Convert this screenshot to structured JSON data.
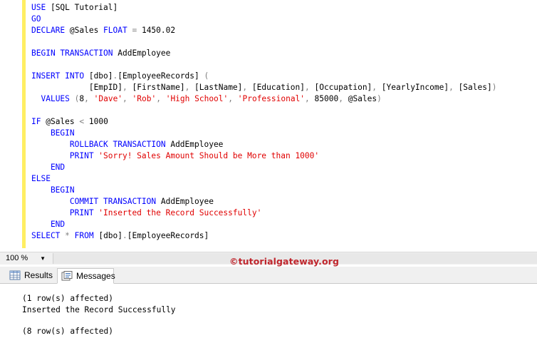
{
  "editor": {
    "lines": [
      [
        {
          "t": "USE ",
          "c": "kw"
        },
        {
          "t": "[SQL Tutorial]",
          "c": "pl"
        }
      ],
      [
        {
          "t": "GO",
          "c": "kw"
        }
      ],
      [
        {
          "t": "DECLARE ",
          "c": "kw"
        },
        {
          "t": "@Sales ",
          "c": "pl"
        },
        {
          "t": "FLOAT ",
          "c": "kw"
        },
        {
          "t": "= ",
          "c": "op"
        },
        {
          "t": "1450.02",
          "c": "pl"
        }
      ],
      [],
      [
        {
          "t": "BEGIN TRANSACTION ",
          "c": "kw"
        },
        {
          "t": "AddEmployee",
          "c": "pl"
        }
      ],
      [],
      [
        {
          "t": "INSERT INTO ",
          "c": "kw"
        },
        {
          "t": "[dbo]",
          "c": "pl"
        },
        {
          "t": ".",
          "c": "op"
        },
        {
          "t": "[EmployeeRecords] ",
          "c": "pl"
        },
        {
          "t": "(",
          "c": "op"
        }
      ],
      [
        {
          "t": "            ",
          "c": "pl"
        },
        {
          "t": "[EmpID]",
          "c": "pl"
        },
        {
          "t": ", ",
          "c": "op"
        },
        {
          "t": "[FirstName]",
          "c": "pl"
        },
        {
          "t": ", ",
          "c": "op"
        },
        {
          "t": "[LastName]",
          "c": "pl"
        },
        {
          "t": ", ",
          "c": "op"
        },
        {
          "t": "[Education]",
          "c": "pl"
        },
        {
          "t": ", ",
          "c": "op"
        },
        {
          "t": "[Occupation]",
          "c": "pl"
        },
        {
          "t": ", ",
          "c": "op"
        },
        {
          "t": "[YearlyIncome]",
          "c": "pl"
        },
        {
          "t": ", ",
          "c": "op"
        },
        {
          "t": "[Sales]",
          "c": "pl"
        },
        {
          "t": ")",
          "c": "op"
        }
      ],
      [
        {
          "t": "  ",
          "c": "pl"
        },
        {
          "t": "VALUES ",
          "c": "kw"
        },
        {
          "t": "(",
          "c": "op"
        },
        {
          "t": "8",
          "c": "pl"
        },
        {
          "t": ", ",
          "c": "op"
        },
        {
          "t": "'Dave'",
          "c": "str"
        },
        {
          "t": ", ",
          "c": "op"
        },
        {
          "t": "'Rob'",
          "c": "str"
        },
        {
          "t": ", ",
          "c": "op"
        },
        {
          "t": "'High School'",
          "c": "str"
        },
        {
          "t": ", ",
          "c": "op"
        },
        {
          "t": "'Professional'",
          "c": "str"
        },
        {
          "t": ", ",
          "c": "op"
        },
        {
          "t": "85000",
          "c": "pl"
        },
        {
          "t": ", ",
          "c": "op"
        },
        {
          "t": "@Sales",
          "c": "pl"
        },
        {
          "t": ")",
          "c": "op"
        }
      ],
      [],
      [
        {
          "t": "IF ",
          "c": "kw"
        },
        {
          "t": "@Sales ",
          "c": "pl"
        },
        {
          "t": "< ",
          "c": "op"
        },
        {
          "t": "1000",
          "c": "pl"
        }
      ],
      [
        {
          "t": "    BEGIN",
          "c": "kw"
        }
      ],
      [
        {
          "t": "        ROLLBACK TRANSACTION ",
          "c": "kw"
        },
        {
          "t": "AddEmployee",
          "c": "pl"
        }
      ],
      [
        {
          "t": "        PRINT ",
          "c": "kw"
        },
        {
          "t": "'Sorry! Sales Amount Should be More than 1000'",
          "c": "str"
        }
      ],
      [
        {
          "t": "    END",
          "c": "kw"
        }
      ],
      [
        {
          "t": "ELSE",
          "c": "kw"
        }
      ],
      [
        {
          "t": "    BEGIN",
          "c": "kw"
        }
      ],
      [
        {
          "t": "        COMMIT TRANSACTION ",
          "c": "kw"
        },
        {
          "t": "AddEmployee",
          "c": "pl"
        }
      ],
      [
        {
          "t": "        PRINT ",
          "c": "kw"
        },
        {
          "t": "'Inserted the Record Successfully'",
          "c": "str"
        }
      ],
      [
        {
          "t": "    END",
          "c": "kw"
        }
      ],
      [
        {
          "t": "SELECT ",
          "c": "kw"
        },
        {
          "t": "* ",
          "c": "op"
        },
        {
          "t": "FROM ",
          "c": "kw"
        },
        {
          "t": "[dbo]",
          "c": "pl"
        },
        {
          "t": ".",
          "c": "op"
        },
        {
          "t": "[EmployeeRecords]",
          "c": "pl"
        }
      ]
    ]
  },
  "zoom": {
    "value": "100 %"
  },
  "watermark": "©tutorialgateway.org",
  "tabs": {
    "results": "Results",
    "messages": "Messages"
  },
  "messages": [
    "(1 row(s) affected)",
    "Inserted the Record Successfully",
    "",
    "(8 row(s) affected)"
  ],
  "colors": {
    "keyword": "#0000ff",
    "string": "#e00000",
    "operator": "#808080",
    "change_bar": "#ffee62",
    "watermark": "#c0262d"
  }
}
